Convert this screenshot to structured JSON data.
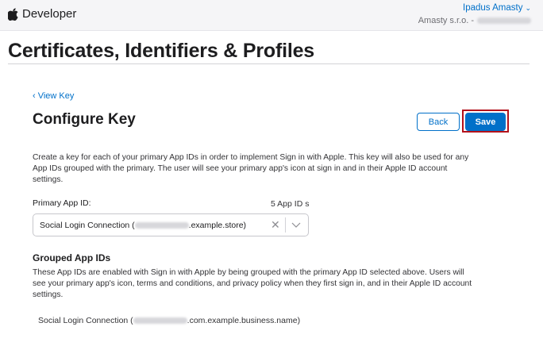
{
  "header": {
    "brand": "Developer",
    "user_name": "Ipadus Amasty",
    "user_chevron": "⌄",
    "team_name": "Amasty s.r.o. -"
  },
  "page": {
    "title": "Certificates, Identifiers & Profiles"
  },
  "configure": {
    "back_link": "‹ View Key",
    "heading": "Configure Key",
    "back_button": "Back",
    "save_button": "Save",
    "description": "Create a key for each of your primary App IDs in order to implement Sign in with Apple. This key will also be used for any App IDs grouped with the primary. The user will see your primary app's icon at sign in and in their Apple ID account settings.",
    "primary_label": "Primary App ID:",
    "app_id_count": "5 App ID s",
    "primary_select": {
      "prefix": "Social Login Connection (",
      "suffix": ".example.store)"
    },
    "grouped_title": "Grouped App IDs",
    "grouped_description": "These App IDs are enabled with Sign in with Apple by being grouped with the primary App ID selected above. Users will see your primary app's icon, terms and conditions, and privacy policy when they first sign in, and in their Apple ID account settings.",
    "grouped_items": [
      {
        "prefix": "Social Login Connection (",
        "suffix": ".com.example.business.name)"
      }
    ]
  },
  "colors": {
    "link_blue": "#0070c9",
    "highlight_red": "#b3121b"
  },
  "icons": {
    "logo": "apple-logo-icon",
    "clear": "clear-icon",
    "dropdown": "chevron-down-icon"
  }
}
